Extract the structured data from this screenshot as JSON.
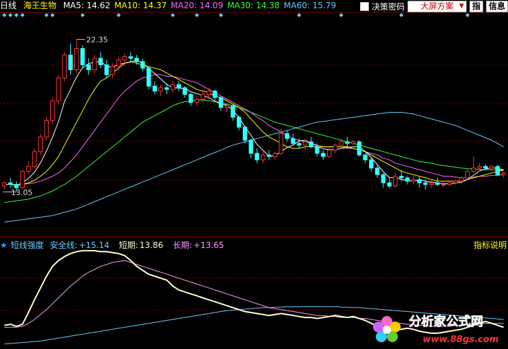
{
  "header": {
    "period": "日线",
    "stock": "海王生物",
    "ma": [
      {
        "label": "MA5: 14.62",
        "color": "#ffffff"
      },
      {
        "label": "MA10: 14.37",
        "color": "#ffff00"
      },
      {
        "label": "MA20: 14.09",
        "color": "#ff66ff"
      },
      {
        "label": "MA30: 14.38",
        "color": "#33ff33"
      },
      {
        "label": "MA60: 15.79",
        "color": "#66ccff"
      }
    ]
  },
  "toolbar": {
    "decision_label": "决策密码",
    "plan_label": "大屏方案",
    "plan_arrow": "▼",
    "tab_icon": "指",
    "info_label": "信息"
  },
  "indicator": {
    "star": "★",
    "name": "短线强度",
    "safe_label": "安全线:",
    "safe_value": "+15.14",
    "short_label": "短期:",
    "short_value": "13.86",
    "long_label": "长期:",
    "long_value": "+13.65",
    "help_label": "指标说明"
  },
  "annotations": {
    "high_label": "22.35",
    "low_label": "13.05"
  },
  "watermark": {
    "title": "分析家公式网",
    "url": "www.88gs.com"
  },
  "colors": {
    "up": "#ff3333",
    "down": "#33ffff",
    "ma5": "#ffffff",
    "ma10": "#ffff00",
    "ma20": "#ff66ff",
    "ma30": "#33ff33",
    "ma60": "#66ccff",
    "grid": "#800000",
    "short": "#ffffcc",
    "long": "#ff99ff",
    "safe": "#66ccff"
  },
  "chart_data": {
    "type": "candlestick",
    "ylim": [
      10.5,
      23.5
    ],
    "candles": [
      [
        13.4,
        13.7,
        13.2,
        13.6
      ],
      [
        13.6,
        13.9,
        13.3,
        13.5
      ],
      [
        13.5,
        13.7,
        13.05,
        13.3
      ],
      [
        13.3,
        14.4,
        13.2,
        14.3
      ],
      [
        14.3,
        14.9,
        14.1,
        14.6
      ],
      [
        14.6,
        15.7,
        14.5,
        15.5
      ],
      [
        15.5,
        16.6,
        15.3,
        16.4
      ],
      [
        16.4,
        17.6,
        16.2,
        17.4
      ],
      [
        17.4,
        18.8,
        17.2,
        18.6
      ],
      [
        18.6,
        20.2,
        18.4,
        20.0
      ],
      [
        20.0,
        21.6,
        19.8,
        21.4
      ],
      [
        21.4,
        22.1,
        20.2,
        20.5
      ],
      [
        20.5,
        22.35,
        20.3,
        21.8
      ],
      [
        21.8,
        22.0,
        20.6,
        20.8
      ],
      [
        20.8,
        21.2,
        20.2,
        20.5
      ],
      [
        20.5,
        21.4,
        20.3,
        21.2
      ],
      [
        21.2,
        21.6,
        20.6,
        20.8
      ],
      [
        20.8,
        21.1,
        20.0,
        20.2
      ],
      [
        20.2,
        20.9,
        20.0,
        20.7
      ],
      [
        20.7,
        21.3,
        20.5,
        21.1
      ],
      [
        21.1,
        21.5,
        20.8,
        21.3
      ],
      [
        21.3,
        21.6,
        21.0,
        21.2
      ],
      [
        21.2,
        21.4,
        20.8,
        21.0
      ],
      [
        21.0,
        21.2,
        20.4,
        20.6
      ],
      [
        20.6,
        20.7,
        19.3,
        19.5
      ],
      [
        19.5,
        19.8,
        19.0,
        19.2
      ],
      [
        19.2,
        19.6,
        18.9,
        19.4
      ],
      [
        19.4,
        19.7,
        19.0,
        19.3
      ],
      [
        19.3,
        19.8,
        19.1,
        19.6
      ],
      [
        19.6,
        19.8,
        19.2,
        19.4
      ],
      [
        19.4,
        19.5,
        18.8,
        19.0
      ],
      [
        19.0,
        19.1,
        18.3,
        18.5
      ],
      [
        18.5,
        18.9,
        18.3,
        18.7
      ],
      [
        18.7,
        19.2,
        18.5,
        19.0
      ],
      [
        19.0,
        19.4,
        18.7,
        19.2
      ],
      [
        19.2,
        19.3,
        18.6,
        18.8
      ],
      [
        18.8,
        18.9,
        18.0,
        18.2
      ],
      [
        18.2,
        18.5,
        17.9,
        18.3
      ],
      [
        18.3,
        18.4,
        17.4,
        17.6
      ],
      [
        17.6,
        17.7,
        16.8,
        17.0
      ],
      [
        17.0,
        17.1,
        16.0,
        16.2
      ],
      [
        16.2,
        16.3,
        15.1,
        15.4
      ],
      [
        15.4,
        15.7,
        14.8,
        15.0
      ],
      [
        15.0,
        15.5,
        14.8,
        15.3
      ],
      [
        15.3,
        15.6,
        15.0,
        15.2
      ],
      [
        15.2,
        15.5,
        15.0,
        15.4
      ],
      [
        15.4,
        16.9,
        15.3,
        16.6
      ],
      [
        16.6,
        16.8,
        16.1,
        16.3
      ],
      [
        16.3,
        16.6,
        15.9,
        16.0
      ],
      [
        16.0,
        16.3,
        15.7,
        15.9
      ],
      [
        15.9,
        16.2,
        15.6,
        16.1
      ],
      [
        16.1,
        16.4,
        15.7,
        15.8
      ],
      [
        15.8,
        16.0,
        15.2,
        15.4
      ],
      [
        15.4,
        15.6,
        15.0,
        15.2
      ],
      [
        15.2,
        15.8,
        15.1,
        15.6
      ],
      [
        15.6,
        16.0,
        15.4,
        15.9
      ],
      [
        15.9,
        16.3,
        15.7,
        16.1
      ],
      [
        16.1,
        16.4,
        15.8,
        16.0
      ],
      [
        16.0,
        16.2,
        15.9,
        16.1
      ],
      [
        16.1,
        16.2,
        15.2,
        15.3
      ],
      [
        15.3,
        15.4,
        14.8,
        15.0
      ],
      [
        15.0,
        15.1,
        14.3,
        14.5
      ],
      [
        14.5,
        14.7,
        13.9,
        14.1
      ],
      [
        14.1,
        14.2,
        13.3,
        13.6
      ],
      [
        13.6,
        13.9,
        13.3,
        13.4
      ],
      [
        13.4,
        14.2,
        13.3,
        14.0
      ],
      [
        14.0,
        14.4,
        13.7,
        13.9
      ],
      [
        13.9,
        14.0,
        13.5,
        13.7
      ],
      [
        13.7,
        14.0,
        13.5,
        13.8
      ],
      [
        13.8,
        14.0,
        13.3,
        13.6
      ],
      [
        13.6,
        13.8,
        13.2,
        13.5
      ],
      [
        13.5,
        13.8,
        13.3,
        13.6
      ],
      [
        13.6,
        13.9,
        13.4,
        13.5
      ],
      [
        13.5,
        13.7,
        13.3,
        13.5
      ],
      [
        13.5,
        13.7,
        13.4,
        13.6
      ],
      [
        13.6,
        13.8,
        13.5,
        13.7
      ],
      [
        13.7,
        14.0,
        13.5,
        13.9
      ],
      [
        13.9,
        14.4,
        13.8,
        14.3
      ],
      [
        14.3,
        15.2,
        14.2,
        14.5
      ],
      [
        14.5,
        14.8,
        14.3,
        14.6
      ],
      [
        14.6,
        14.7,
        14.4,
        14.5
      ],
      [
        14.5,
        14.7,
        14.3,
        14.6
      ],
      [
        14.6,
        14.7,
        14.0,
        14.1
      ],
      [
        14.1,
        14.3,
        13.9,
        14.2
      ]
    ],
    "ma5": [
      13.5,
      13.5,
      13.45,
      13.6,
      13.86,
      14.24,
      14.82,
      15.54,
      16.38,
      17.34,
      18.56,
      19.3,
      20.06,
      20.62,
      20.88,
      20.96,
      21.02,
      20.7,
      20.66,
      20.82,
      20.9,
      20.98,
      21.08,
      20.9,
      20.58,
      20.26,
      19.94,
      19.6,
      19.4,
      19.38,
      19.36,
      19.16,
      19.04,
      18.92,
      18.8,
      18.58,
      18.4,
      18.34,
      18.02,
      17.58,
      17.02,
      16.5,
      15.94,
      15.58,
      15.22,
      15.26,
      15.5,
      15.76,
      15.9,
      16.16,
      16.2,
      16.02,
      15.84,
      15.68,
      15.62,
      15.62,
      15.7,
      15.76,
      15.8,
      15.8,
      15.5,
      15.14,
      14.72,
      14.28,
      13.92,
      13.92,
      13.8,
      13.74,
      13.7,
      13.8,
      13.7,
      13.64,
      13.6,
      13.54,
      13.54,
      13.58,
      13.64,
      13.8,
      14.06,
      14.32,
      14.44,
      14.52,
      14.48,
      14.4
    ],
    "ma10": [
      13.5,
      13.5,
      13.45,
      13.5,
      13.6,
      13.75,
      14.0,
      14.3,
      14.7,
      15.2,
      15.9,
      16.6,
      17.3,
      18.0,
      18.7,
      19.3,
      19.8,
      20.0,
      20.3,
      20.6,
      20.9,
      21.0,
      20.9,
      20.8,
      20.7,
      20.6,
      20.5,
      20.3,
      20.1,
      19.9,
      19.7,
      19.5,
      19.3,
      19.2,
      19.1,
      18.9,
      18.8,
      18.6,
      18.4,
      18.2,
      17.9,
      17.5,
      17.1,
      16.7,
      16.4,
      16.2,
      16.0,
      15.8,
      15.7,
      15.7,
      15.8,
      15.8,
      15.8,
      15.8,
      15.8,
      15.8,
      15.8,
      15.8,
      15.7,
      15.6,
      15.5,
      15.3,
      15.1,
      14.9,
      14.7,
      14.5,
      14.3,
      14.2,
      14.1,
      14.0,
      13.9,
      13.8,
      13.7,
      13.7,
      13.7,
      13.7,
      13.7,
      13.8,
      13.9,
      14.0,
      14.1,
      14.2,
      14.3,
      14.37
    ],
    "ma20": [
      13.5,
      13.5,
      13.5,
      13.5,
      13.55,
      13.6,
      13.7,
      13.85,
      14.0,
      14.2,
      14.5,
      14.9,
      15.3,
      15.8,
      16.3,
      16.8,
      17.3,
      17.8,
      18.3,
      18.8,
      19.2,
      19.5,
      19.8,
      20.0,
      20.1,
      20.2,
      20.2,
      20.1,
      20.1,
      20.0,
      19.9,
      19.8,
      19.7,
      19.5,
      19.3,
      19.1,
      18.9,
      18.7,
      18.5,
      18.3,
      18.1,
      17.9,
      17.6,
      17.4,
      17.1,
      16.9,
      16.7,
      16.5,
      16.3,
      16.2,
      16.1,
      16.0,
      15.9,
      15.8,
      15.8,
      15.8,
      15.8,
      15.7,
      15.7,
      15.6,
      15.5,
      15.4,
      15.3,
      15.1,
      15.0,
      14.8,
      14.7,
      14.6,
      14.5,
      14.4,
      14.3,
      14.2,
      14.1,
      14.0,
      14.0,
      13.95,
      13.9,
      13.9,
      13.95,
      14.0,
      14.0,
      14.05,
      14.05,
      14.09
    ],
    "ma30": [
      12.4,
      12.45,
      12.5,
      12.55,
      12.6,
      12.7,
      12.8,
      12.95,
      13.1,
      13.3,
      13.5,
      13.75,
      14.0,
      14.3,
      14.6,
      14.9,
      15.2,
      15.5,
      15.8,
      16.1,
      16.4,
      16.7,
      17.0,
      17.3,
      17.5,
      17.7,
      17.9,
      18.1,
      18.3,
      18.45,
      18.55,
      18.6,
      18.65,
      18.65,
      18.6,
      18.55,
      18.5,
      18.4,
      18.3,
      18.2,
      18.05,
      17.9,
      17.75,
      17.6,
      17.45,
      17.3,
      17.2,
      17.1,
      17.0,
      16.9,
      16.8,
      16.7,
      16.6,
      16.5,
      16.4,
      16.3,
      16.2,
      16.1,
      16.0,
      15.9,
      15.8,
      15.7,
      15.6,
      15.5,
      15.4,
      15.3,
      15.2,
      15.1,
      15.0,
      14.9,
      14.85,
      14.8,
      14.7,
      14.65,
      14.6,
      14.55,
      14.5,
      14.45,
      14.45,
      14.4,
      14.4,
      14.4,
      14.38,
      14.38
    ],
    "ma60": [
      11.2,
      11.25,
      11.3,
      11.35,
      11.4,
      11.45,
      11.5,
      11.55,
      11.6,
      11.7,
      11.8,
      11.9,
      12.0,
      12.15,
      12.3,
      12.45,
      12.6,
      12.75,
      12.9,
      13.05,
      13.2,
      13.35,
      13.5,
      13.65,
      13.8,
      13.95,
      14.1,
      14.25,
      14.4,
      14.55,
      14.7,
      14.85,
      15.0,
      15.15,
      15.3,
      15.45,
      15.6,
      15.75,
      15.9,
      16.0,
      16.1,
      16.2,
      16.3,
      16.4,
      16.5,
      16.6,
      16.7,
      16.8,
      16.9,
      17.0,
      17.1,
      17.2,
      17.3,
      17.35,
      17.4,
      17.45,
      17.5,
      17.55,
      17.6,
      17.65,
      17.7,
      17.75,
      17.8,
      17.85,
      17.9,
      17.9,
      17.9,
      17.85,
      17.8,
      17.7,
      17.6,
      17.5,
      17.4,
      17.3,
      17.2,
      17.1,
      16.95,
      16.8,
      16.65,
      16.5,
      16.35,
      16.2,
      16.0,
      15.79
    ],
    "osc_ylim": [
      0,
      100
    ],
    "short": [
      22,
      23,
      21,
      23,
      35,
      48,
      60,
      72,
      82,
      88,
      92,
      95,
      97,
      98,
      98,
      98,
      97,
      97,
      96,
      95,
      93,
      88,
      82,
      78,
      74,
      72,
      70,
      68,
      62,
      58,
      56,
      54,
      52,
      50,
      48,
      46,
      44,
      42,
      40,
      38,
      36,
      35,
      34,
      33,
      32,
      33,
      34,
      33,
      32,
      31,
      30,
      30,
      29,
      30,
      31,
      32,
      31,
      30,
      31,
      29,
      27,
      24,
      21,
      18,
      16,
      17,
      18,
      19,
      18,
      16,
      15,
      14,
      14,
      15,
      16,
      17,
      18,
      20,
      22,
      24,
      26,
      24,
      22,
      20
    ],
    "long": [
      20,
      20,
      20,
      21,
      24,
      28,
      33,
      38,
      44,
      50,
      56,
      62,
      67,
      72,
      76,
      79,
      82,
      84,
      86,
      87,
      88,
      86,
      84,
      82,
      80,
      78,
      76,
      74,
      72,
      70,
      68,
      66,
      64,
      62,
      60,
      58,
      56,
      54,
      52,
      50,
      48,
      46,
      44,
      42,
      40,
      39,
      38,
      37,
      36,
      35,
      34,
      33,
      32,
      32,
      31,
      31,
      30,
      30,
      30,
      29,
      29,
      28,
      27,
      26,
      25,
      24,
      24,
      23,
      23,
      22,
      22,
      21,
      21,
      21,
      21,
      22,
      22,
      23,
      23,
      24,
      24,
      24,
      24,
      24
    ],
    "safe": [
      3,
      3.5,
      4,
      4.5,
      5,
      5.5,
      6,
      7,
      8,
      9,
      10,
      11,
      12,
      13,
      14,
      15,
      16,
      17,
      18,
      19,
      20,
      21,
      22,
      23,
      24,
      25,
      26,
      27,
      28,
      29,
      30,
      31,
      32,
      33,
      34,
      35,
      36,
      37,
      37.5,
      38,
      38.5,
      39,
      39.5,
      40,
      40,
      40.5,
      40.5,
      41,
      41,
      41,
      41,
      41,
      41,
      41,
      41,
      41,
      40.5,
      40.5,
      40,
      40,
      39.5,
      39,
      38.5,
      38,
      37.5,
      37,
      36.5,
      36,
      35.5,
      35,
      34.5,
      34,
      33.5,
      33,
      32.5,
      32,
      31.5,
      31,
      30.5,
      30,
      29.5,
      29,
      28.5,
      28
    ]
  }
}
